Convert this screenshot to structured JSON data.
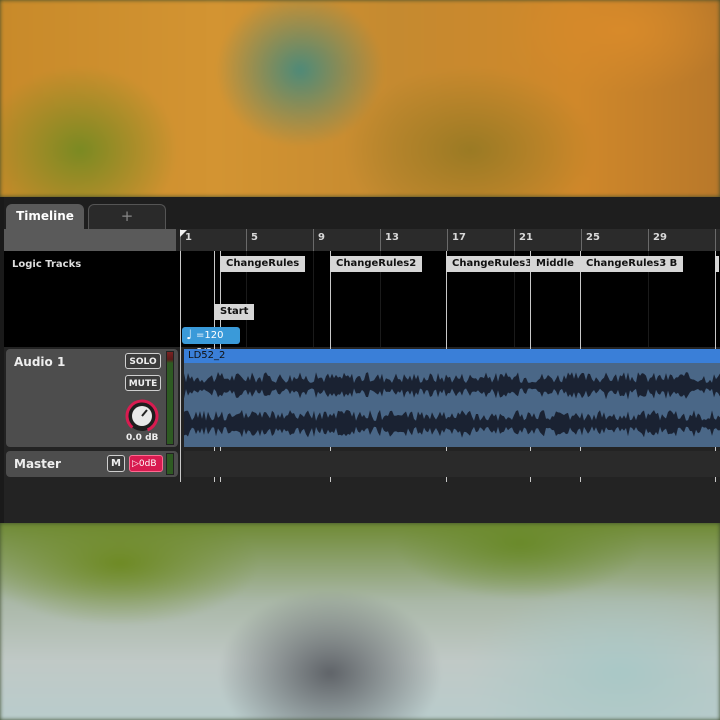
{
  "tabs": [
    {
      "label": "Timeline",
      "active": true
    },
    {
      "label": "+",
      "active": false
    }
  ],
  "ruler": {
    "ticks": [
      "1",
      "5",
      "9",
      "13",
      "17",
      "21",
      "25",
      "29",
      "3"
    ]
  },
  "logic_tracks": {
    "label": "Logic Tracks",
    "markers": [
      {
        "label": "ChangeRules"
      },
      {
        "label": "ChangeRules2"
      },
      {
        "label": "ChangeRules3"
      },
      {
        "label": "Middle"
      },
      {
        "label": "ChangeRules3 B"
      },
      {
        "label": "Start"
      }
    ],
    "tempo": {
      "note": "♩",
      "text": "=120 8/8",
      "color": "#3a9ad9"
    }
  },
  "audio_track": {
    "name": "Audio 1",
    "solo_label": "SOLO",
    "mute_label": "MUTE",
    "volume": "0.0 dB",
    "knob_color": "#d81b50",
    "clip": {
      "name": "LD52_2",
      "header_color": "#3a7fd8",
      "body_color": "#4a6787"
    }
  },
  "master_track": {
    "name": "Master",
    "mute_label": "M",
    "gain_label": "0dB",
    "gain_color": "#d81b50"
  }
}
